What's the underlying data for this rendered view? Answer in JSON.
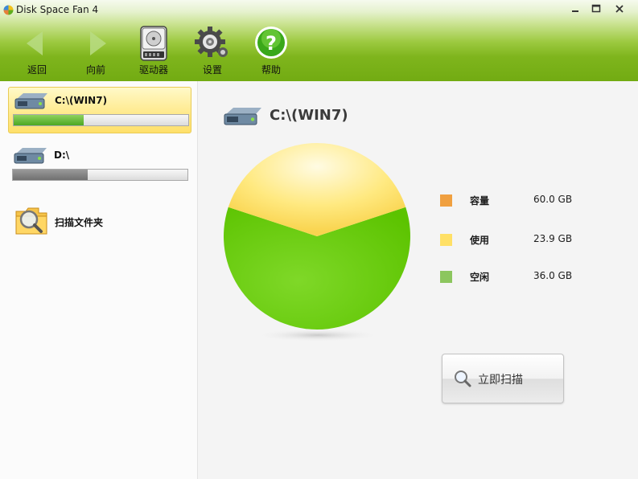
{
  "window": {
    "title": "Disk Space Fan 4"
  },
  "toolbar": {
    "items": [
      {
        "label": "返回",
        "icon": "back-arrow-icon"
      },
      {
        "label": "向前",
        "icon": "forward-arrow-icon"
      },
      {
        "label": "驱动器",
        "icon": "hard-drive-icon"
      },
      {
        "label": "设置",
        "icon": "gear-icon"
      },
      {
        "label": "帮助",
        "icon": "help-icon"
      }
    ]
  },
  "sidebar": {
    "drives": [
      {
        "name": "C:\\(WIN7)",
        "used_fraction": 0.4,
        "selected": true
      },
      {
        "name": "D:\\",
        "used_fraction": 0.43,
        "selected": false
      }
    ],
    "scan_folder_label": "扫描文件夹"
  },
  "main": {
    "title": "C:\\(WIN7)",
    "legend": [
      {
        "label": "容量",
        "value": "60.0 GB",
        "color": "#f0a040"
      },
      {
        "label": "使用",
        "value": "23.9 GB",
        "color": "#ffe066"
      },
      {
        "label": "空闲",
        "value": "36.0 GB",
        "color": "#8cc65e"
      }
    ],
    "scan_button_label": "立即扫描"
  },
  "chart_data": {
    "type": "pie",
    "labels": [
      "使用",
      "空闲"
    ],
    "values": [
      23.9,
      36.0
    ],
    "colors": [
      "#ffe066",
      "#66cc00"
    ]
  }
}
